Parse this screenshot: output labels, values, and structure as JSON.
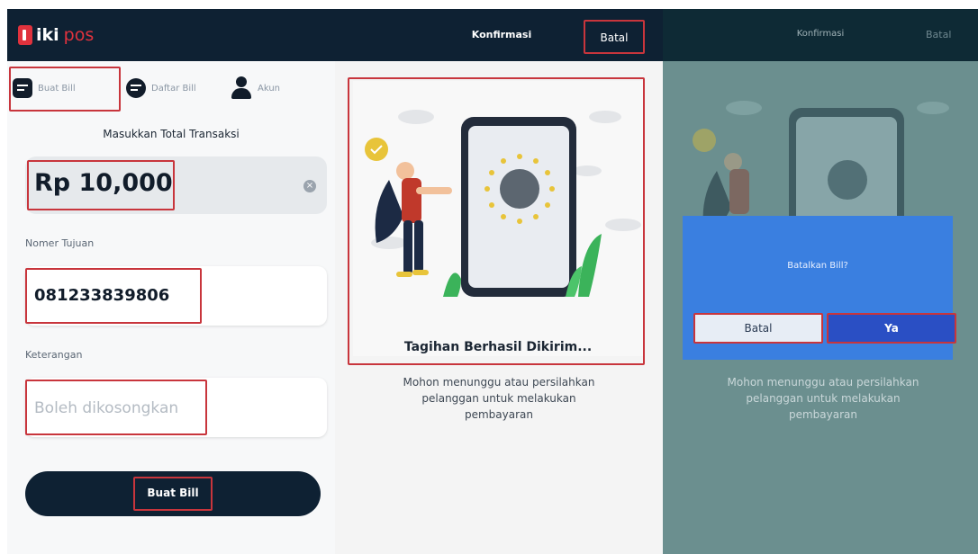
{
  "panel1": {
    "logo": {
      "iki": "iki",
      "pos": "pos"
    },
    "tabs": [
      {
        "label": "Buat Bill",
        "icon": "receipt-icon"
      },
      {
        "label": "Daftar Bill",
        "icon": "list-icon"
      },
      {
        "label": "Akun",
        "icon": "user-icon"
      }
    ],
    "prompt": "Masukkan Total Transaksi",
    "amount": "Rp 10,000",
    "phone_label": "Nomer Tujuan",
    "phone_value": "081233839806",
    "note_label": "Keterangan",
    "note_placeholder": "Boleh dikosongkan",
    "submit_label": "Buat Bill"
  },
  "panel2": {
    "title": "Konfirmasi",
    "cancel_label": "Batal",
    "success_text": "Tagihan Berhasil Dikirim...",
    "note": "Mohon menunggu atau persilahkan pelanggan untuk melakukan pembayaran"
  },
  "panel3": {
    "title": "Konfirmasi",
    "cancel_label": "Batal",
    "dialog_title": "Batalkan Bill?",
    "dialog_cancel": "Batal",
    "dialog_confirm": "Ya",
    "note": "Mohon menunggu atau persilahkan pelanggan untuk melakukan pembayaran"
  },
  "colors": {
    "header": "#0e2133",
    "accent_red": "#e0323d",
    "highlight": "#c8353c",
    "dialog_blue": "#3a7fe0",
    "overlay": "#6b8f8f"
  }
}
